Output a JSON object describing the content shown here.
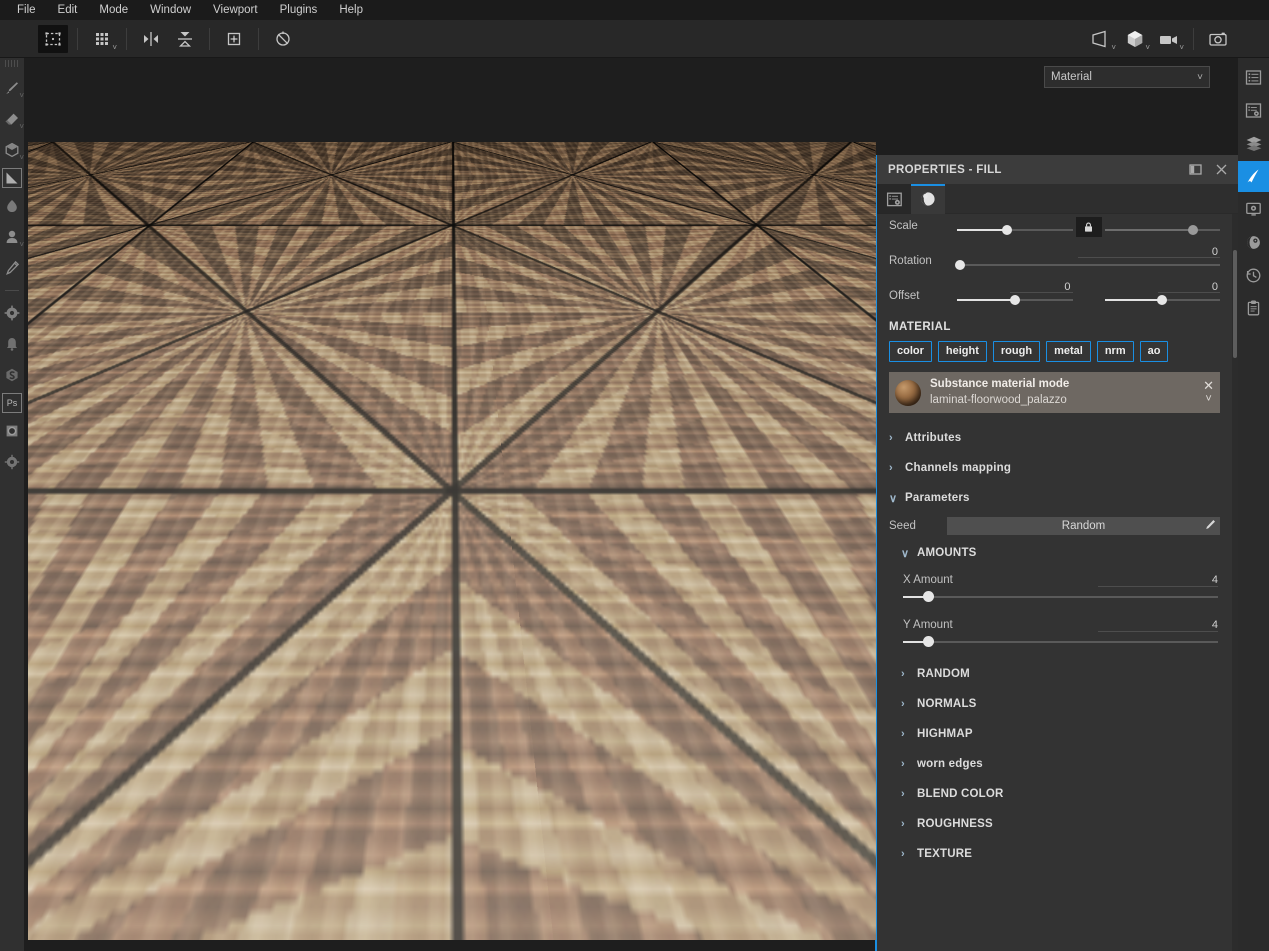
{
  "app": {
    "accent": "#1a8fe3",
    "panel_bg": "#333333",
    "toolbar_bg": "#282828",
    "menubar_bg": "#1b1b1b"
  },
  "menubar": {
    "items": [
      {
        "label": "File"
      },
      {
        "label": "Edit"
      },
      {
        "label": "Mode"
      },
      {
        "label": "Window"
      },
      {
        "label": "Viewport"
      },
      {
        "label": "Plugins"
      },
      {
        "label": "Help"
      }
    ]
  },
  "toolbar": {
    "left_items": [
      {
        "name": "selection-tool",
        "icon": "dashed-box-icon",
        "active": true
      },
      {
        "name": "uv-tiles-tool",
        "icon": "grid-dots-icon",
        "active": false,
        "has_dropdown": true
      },
      {
        "name": "symmetry-horizontal",
        "icon": "mirror-horizontal-icon",
        "active": false
      },
      {
        "name": "symmetry-vertical",
        "icon": "mirror-vertical-icon",
        "active": false
      },
      {
        "name": "center-pivot",
        "icon": "target-box-icon",
        "active": false
      },
      {
        "name": "reset-transform",
        "icon": "reset-circle-icon",
        "active": false
      }
    ],
    "right_items": [
      {
        "name": "viewport-display",
        "icon": "frustum-icon",
        "has_dropdown": true
      },
      {
        "name": "shading-mode",
        "icon": "cube-icon",
        "has_dropdown": true
      },
      {
        "name": "camera-render",
        "icon": "video-camera-icon",
        "has_dropdown": true
      },
      {
        "name": "screenshot",
        "icon": "photo-camera-icon",
        "has_dropdown": false
      }
    ]
  },
  "left_rail": {
    "items": [
      {
        "name": "tool-paint-brush",
        "icon": "brush-icon",
        "has_dropdown": true
      },
      {
        "name": "tool-eraser",
        "icon": "eraser-icon",
        "has_dropdown": true
      },
      {
        "name": "tool-projection",
        "icon": "cube-outline-icon",
        "has_dropdown": true
      },
      {
        "name": "tool-geometry-fill",
        "icon": "polygon-fill-icon",
        "has_dropdown": false
      },
      {
        "name": "tool-smudge",
        "icon": "smudge-drop-icon",
        "has_dropdown": false
      },
      {
        "name": "tool-clone-stamp",
        "icon": "stamp-icon",
        "has_dropdown": true
      },
      {
        "name": "tool-eyedropper",
        "icon": "eyedropper-icon",
        "has_dropdown": false
      },
      {
        "name": "tool-substance-particle",
        "icon": "substance-gear-icon",
        "has_dropdown": false
      },
      {
        "name": "tool-physics-paint",
        "icon": "bell-icon",
        "has_dropdown": false
      },
      {
        "name": "tool-substance-s",
        "icon": "substance-s-icon",
        "has_dropdown": false
      },
      {
        "name": "tool-photoshop-link",
        "icon": "ps-icon",
        "has_dropdown": false
      },
      {
        "name": "tool-bake",
        "icon": "bake-sphere-icon",
        "has_dropdown": false
      },
      {
        "name": "tool-substance-settings",
        "icon": "substance-cog-icon",
        "has_dropdown": false
      }
    ]
  },
  "right_rail": {
    "items": [
      {
        "name": "rail-shelf",
        "icon": "list-icon",
        "active": false
      },
      {
        "name": "rail-properties",
        "icon": "settings-list-icon",
        "active": false
      },
      {
        "name": "rail-layers",
        "icon": "layers-icon",
        "active": false
      },
      {
        "name": "rail-paint",
        "icon": "paint-stroke-icon",
        "active": true
      },
      {
        "name": "rail-display-settings",
        "icon": "monitor-gear-icon",
        "active": false
      },
      {
        "name": "rail-shader-settings",
        "icon": "sphere-gear-icon",
        "active": false
      },
      {
        "name": "rail-history",
        "icon": "history-clock-icon",
        "active": false
      },
      {
        "name": "rail-log",
        "icon": "clipboard-log-icon",
        "active": false
      }
    ]
  },
  "viewport": {
    "material_select": {
      "value": "Material",
      "icon": "chevron-down-icon"
    }
  },
  "panel": {
    "title": "PROPERTIES - FILL",
    "header_buttons": [
      {
        "name": "dock-panel-button",
        "icon": "split-panel-icon"
      },
      {
        "name": "close-panel-button",
        "icon": "close-icon"
      }
    ],
    "tabs": [
      {
        "name": "tab-fill-properties",
        "icon": "properties-gear-icon",
        "active": false
      },
      {
        "name": "tab-material-properties",
        "icon": "material-sphere-icon",
        "active": true
      }
    ],
    "transform": {
      "scale": {
        "label": "Scale",
        "u_slider_pct": 43,
        "v_slider_pct": 77,
        "lock_icon": "link-lock-icon"
      },
      "rotation": {
        "label": "Rotation",
        "value": "0",
        "slider_pct": 0
      },
      "offset": {
        "label": "Offset",
        "u_value": "0",
        "v_value": "0",
        "u_slider_pct": 50,
        "v_slider_pct": 50
      }
    },
    "material": {
      "section_label": "MATERIAL",
      "channels": [
        {
          "label": "color"
        },
        {
          "label": "height"
        },
        {
          "label": "rough"
        },
        {
          "label": "metal"
        },
        {
          "label": "nrm"
        },
        {
          "label": "ao"
        }
      ],
      "card": {
        "title": "Substance material mode",
        "subtitle": "laminat-floorwood_palazzo",
        "remove_icon": "close-icon",
        "expand_icon": "chevron-down-icon"
      }
    },
    "sections": [
      {
        "label": "Attributes",
        "expanded": false,
        "indent": 0
      },
      {
        "label": "Channels mapping",
        "expanded": false,
        "indent": 0
      },
      {
        "label": "Parameters",
        "expanded": true,
        "indent": 0
      }
    ],
    "parameters": {
      "seed": {
        "label": "Seed",
        "value": "Random",
        "edit_icon": "pencil-icon"
      },
      "amounts": {
        "label": "AMOUNTS",
        "expanded": true,
        "fields": [
          {
            "label": "X Amount",
            "value": "4",
            "slider_pct": 8
          },
          {
            "label": "Y Amount",
            "value": "4",
            "slider_pct": 8
          }
        ]
      },
      "collapsed_sections": [
        {
          "label": "RANDOM"
        },
        {
          "label": "NORMALS"
        },
        {
          "label": "HIGHMAP"
        },
        {
          "label": "worn edges"
        },
        {
          "label": "BLEND COLOR"
        },
        {
          "label": "ROUGHNESS"
        },
        {
          "label": "TEXTURE"
        }
      ]
    },
    "icons": {
      "collapsed": "›",
      "expanded": "∨"
    }
  }
}
